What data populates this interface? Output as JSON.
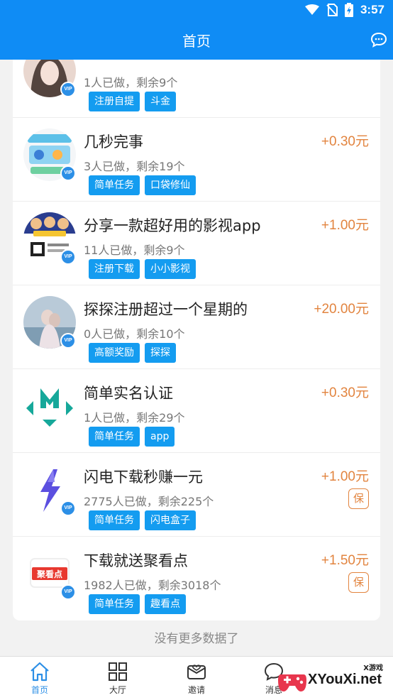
{
  "status": {
    "time": "3:57"
  },
  "header": {
    "title": "首页"
  },
  "tasks": [
    {
      "name": "",
      "stats": "1人已做，剩余9个",
      "price": "",
      "tags": [
        "注册自提",
        "斗金"
      ],
      "insured": false
    },
    {
      "name": "几秒完事",
      "stats": "3人已做，剩余19个",
      "price": "+0.30元",
      "tags": [
        "简单任务",
        "口袋修仙"
      ],
      "insured": false
    },
    {
      "name": "分享一款超好用的影视app",
      "stats": "11人已做，剩余9个",
      "price": "+1.00元",
      "tags": [
        "注册下载",
        "小小影视"
      ],
      "insured": false
    },
    {
      "name": "探探注册超过一个星期的",
      "stats": "0人已做，剩余10个",
      "price": "+20.00元",
      "tags": [
        "高额奖励",
        "探探"
      ],
      "insured": false
    },
    {
      "name": "简单实名认证",
      "stats": "1人已做，剩余29个",
      "price": "+0.30元",
      "tags": [
        "简单任务",
        "app"
      ],
      "insured": false
    },
    {
      "name": "闪电下载秒赚一元",
      "stats": "2775人已做，剩余225个",
      "price": "+1.00元",
      "tags": [
        "简单任务",
        "闪电盒子"
      ],
      "insured": true
    },
    {
      "name": "下载就送聚看点",
      "stats": "1982人已做，剩余3018个",
      "price": "+1.50元",
      "tags": [
        "简单任务",
        "趣看点"
      ],
      "insured": true
    }
  ],
  "badge": {
    "vip": "VIP",
    "insured": "保",
    "jukandian_logo": "聚看点"
  },
  "list_footer": "没有更多数据了",
  "nav": [
    {
      "label": "首页",
      "icon": "home-icon",
      "active": true
    },
    {
      "label": "大厅",
      "icon": "grid-icon",
      "active": false
    },
    {
      "label": "邀请",
      "icon": "invite-icon",
      "active": false
    },
    {
      "label": "消息",
      "icon": "message-icon",
      "active": false
    }
  ],
  "watermark": {
    "text": "XYouXi.net",
    "small": "X游戏"
  },
  "colors": {
    "primary": "#0f8cf5",
    "tag": "#149cf0",
    "price": "#e2843f"
  }
}
